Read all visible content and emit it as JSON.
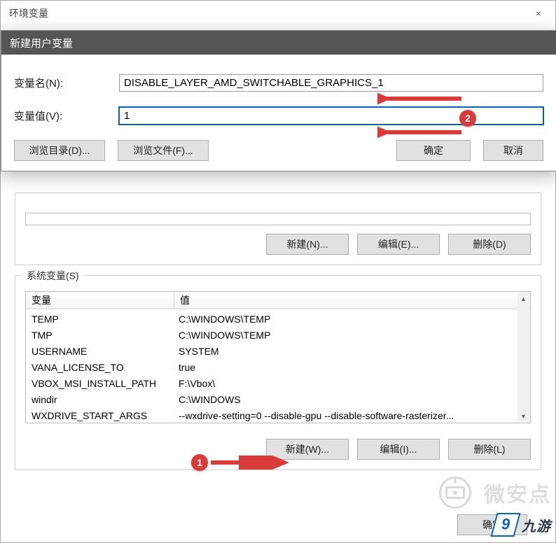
{
  "parent_window": {
    "title": "环境变量",
    "close_icon": "×"
  },
  "new_var_dialog": {
    "title": "新建用户变量",
    "name_label": "变量名(N):",
    "name_value": "DISABLE_LAYER_AMD_SWITCHABLE_GRAPHICS_1",
    "value_label": "变量值(V):",
    "value_value": "1",
    "browse_dir": "浏览目录(D)...",
    "browse_file": "浏览文件(F)...",
    "ok": "确定",
    "cancel": "取消"
  },
  "user_vars_buttons": {
    "new": "新建(N)...",
    "edit": "编辑(E)...",
    "delete": "删除(D)"
  },
  "system_vars": {
    "label": "系统变量(S)",
    "col_var": "变量",
    "col_val": "值",
    "rows": [
      {
        "k": "TEMP",
        "v": "C:\\WINDOWS\\TEMP"
      },
      {
        "k": "TMP",
        "v": "C:\\WINDOWS\\TEMP"
      },
      {
        "k": "USERNAME",
        "v": "SYSTEM"
      },
      {
        "k": "VANA_LICENSE_TO",
        "v": "true"
      },
      {
        "k": "VBOX_MSI_INSTALL_PATH",
        "v": "F:\\Vbox\\"
      },
      {
        "k": "windir",
        "v": "C:\\WINDOWS"
      },
      {
        "k": "WXDRIVE_START_ARGS",
        "v": "--wxdrive-setting=0 --disable-gpu --disable-software-rasterizer..."
      }
    ],
    "buttons": {
      "new": "新建(W)...",
      "edit": "编辑(I)...",
      "delete": "删除(L)"
    }
  },
  "dialog_footer": {
    "ok": "确定"
  },
  "annotations": {
    "badge1": "1",
    "badge2": "2"
  },
  "watermark": {
    "text1": "微安点",
    "text2": "九游"
  }
}
